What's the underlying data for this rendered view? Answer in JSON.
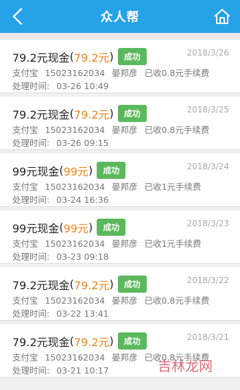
{
  "header": {
    "title": "众人帮",
    "back_icon": "back-chevron-icon",
    "home_icon": "home-icon",
    "bg_color": "#26a3e8"
  },
  "items": [
    {
      "amount": "79.2元现金",
      "paren_open": "(",
      "paren_amount": "79.2元",
      "paren_close": ")",
      "status": "成功",
      "date": "2018/3/26",
      "method": "支付宝",
      "account": "15023162034",
      "name": "晏邦彦",
      "fee": "已收0.8元手续费",
      "time_label": "处理时间:",
      "time": "03-26 10:49"
    },
    {
      "amount": "79.2元现金",
      "paren_open": "(",
      "paren_amount": "79.2元",
      "paren_close": ")",
      "status": "成功",
      "date": "2018/3/25",
      "method": "支付宝",
      "account": "15023162034",
      "name": "晏邦彦",
      "fee": "已收0.8元手续费",
      "time_label": "处理时间:",
      "time": "03-26 09:15"
    },
    {
      "amount": "99元现金",
      "paren_open": "(",
      "paren_amount": "99元",
      "paren_close": ")",
      "status": "成功",
      "date": "2018/3/24",
      "method": "支付宝",
      "account": "15023162034",
      "name": "晏邦彦",
      "fee": "已收1元手续费",
      "time_label": "处理时间:",
      "time": "03-24 16:36"
    },
    {
      "amount": "99元现金",
      "paren_open": "(",
      "paren_amount": "99元",
      "paren_close": ")",
      "status": "成功",
      "date": "2018/3/23",
      "method": "支付宝",
      "account": "15023162034",
      "name": "晏邦彦",
      "fee": "已收1元手续费",
      "time_label": "处理时间:",
      "time": "03-23 09:18"
    },
    {
      "amount": "79.2元现金",
      "paren_open": "(",
      "paren_amount": "79.2元",
      "paren_close": ")",
      "status": "成功",
      "date": "2018/3/22",
      "method": "支付宝",
      "account": "15023162034",
      "name": "晏邦彦",
      "fee": "已收0.8元手续费",
      "time_label": "处理时间:",
      "time": "03-22 13:41"
    },
    {
      "amount": "79.2元现金",
      "paren_open": "(",
      "paren_amount": "79.2元",
      "paren_close": ")",
      "status": "成功",
      "date": "2018/3/21",
      "method": "支付宝",
      "account": "15023162034",
      "name": "晏邦彦",
      "fee": "已收0.8元手续费",
      "time_label": "处理时间:",
      "time": "03-21 10:17"
    }
  ],
  "colors": {
    "accent_amount": "#f08519",
    "status_success": "#5cb85c"
  },
  "watermark": "吉林龙网"
}
